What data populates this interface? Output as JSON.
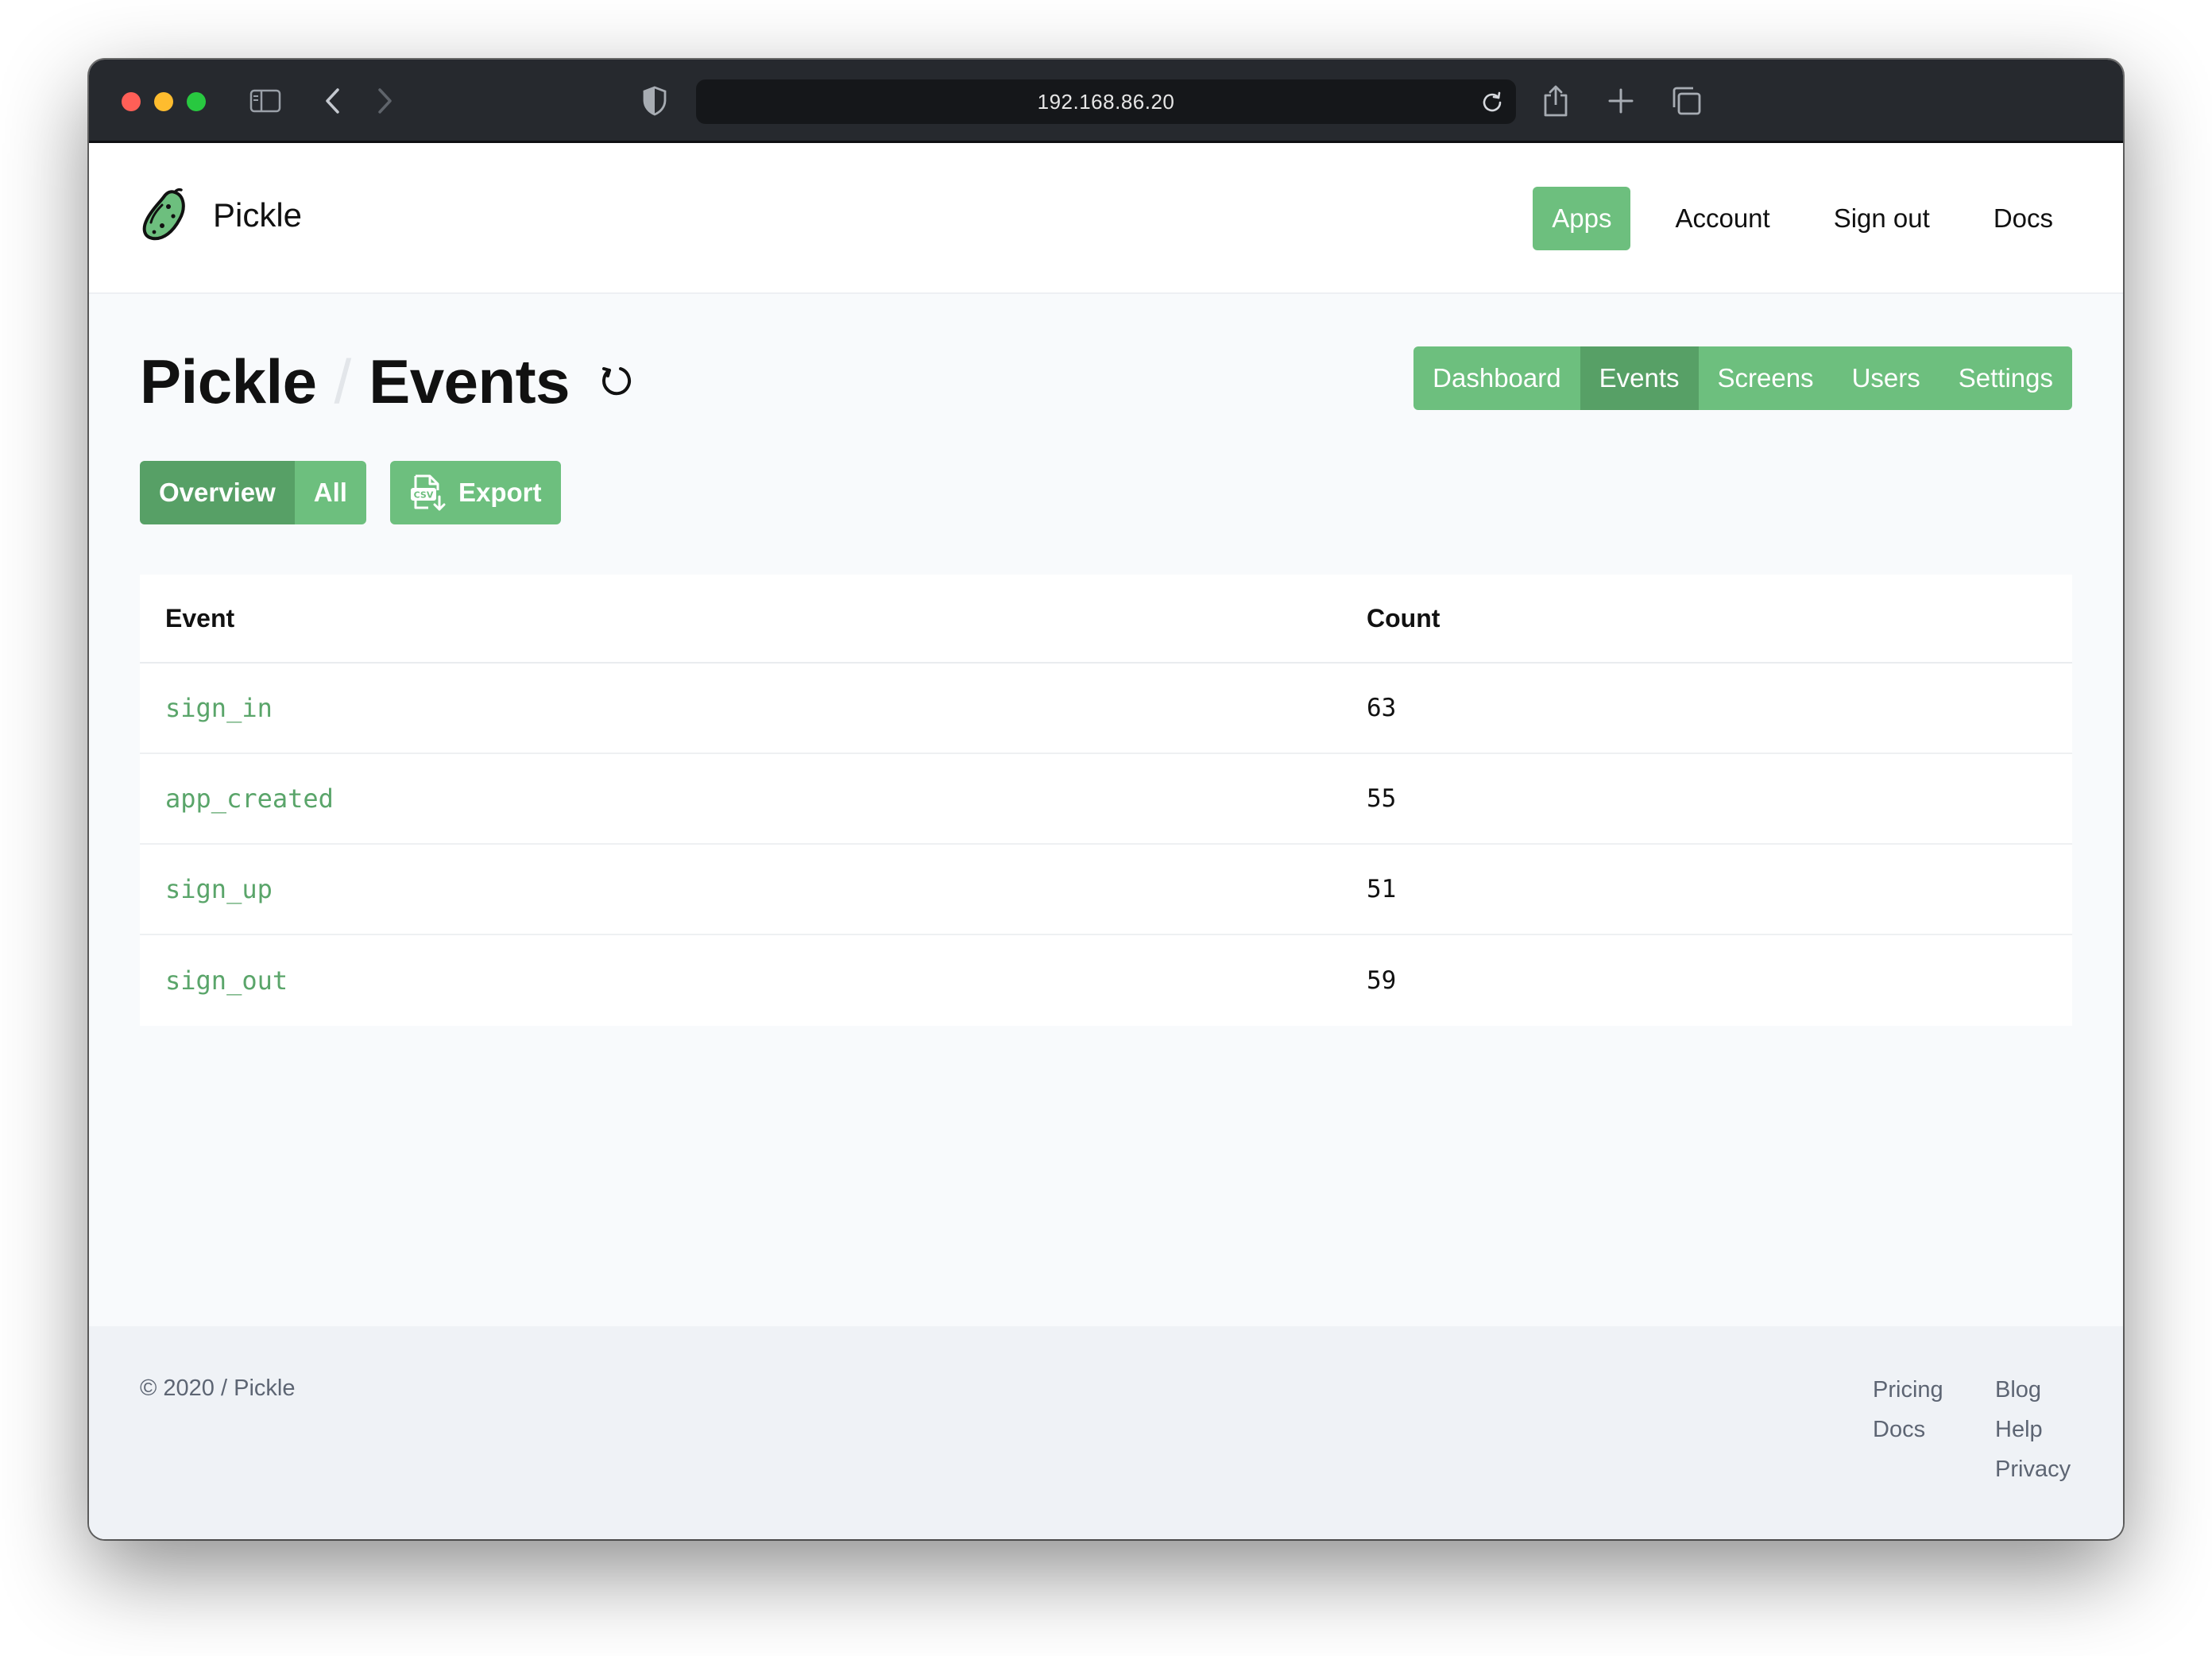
{
  "browser": {
    "url": "192.168.86.20"
  },
  "header": {
    "brand": "Pickle",
    "nav": [
      {
        "label": "Apps",
        "active": true
      },
      {
        "label": "Account"
      },
      {
        "label": "Sign out"
      },
      {
        "label": "Docs"
      }
    ]
  },
  "page": {
    "breadcrumb_app": "Pickle",
    "breadcrumb_sep": "/",
    "breadcrumb_page": "Events",
    "subnav": [
      {
        "label": "Dashboard"
      },
      {
        "label": "Events",
        "active": true
      },
      {
        "label": "Screens"
      },
      {
        "label": "Users"
      },
      {
        "label": "Settings"
      }
    ],
    "view_toggle": [
      {
        "label": "Overview",
        "active": true
      },
      {
        "label": "All"
      }
    ],
    "export_label": "Export",
    "export_icon": "csv-download-icon"
  },
  "table": {
    "columns": [
      "Event",
      "Count"
    ],
    "rows": [
      {
        "event": "sign_in",
        "count": "63"
      },
      {
        "event": "app_created",
        "count": "55"
      },
      {
        "event": "sign_up",
        "count": "51"
      },
      {
        "event": "sign_out",
        "count": "59"
      }
    ]
  },
  "footer": {
    "copyright": "© 2020 / Pickle",
    "col1": [
      "Pricing",
      "Docs"
    ],
    "col2": [
      "Blog",
      "Help",
      "Privacy"
    ]
  },
  "colors": {
    "accent": "#6dbf7e",
    "accent_active": "#57a066",
    "link": "#5aa56a",
    "chrome": "#26292e"
  }
}
